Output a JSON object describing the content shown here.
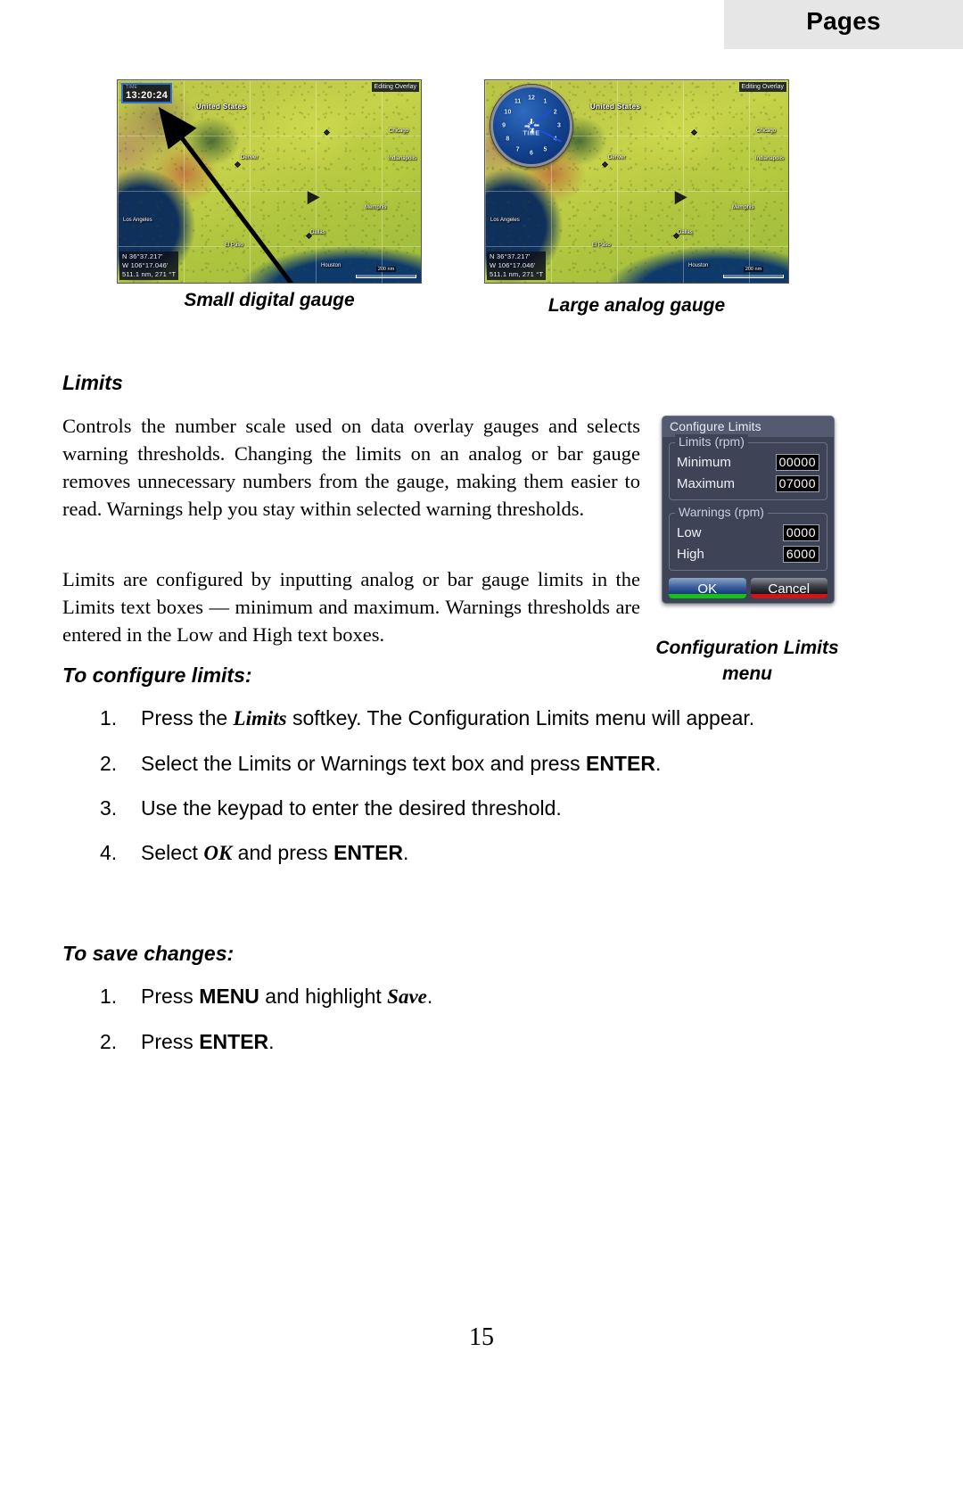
{
  "header": {
    "title": "Pages"
  },
  "figures": [
    {
      "caption": "Small digital gauge",
      "overlay_edit": "Editing Overlay",
      "gauge_label": "TIME",
      "gauge_value": "13:20:24",
      "position_lines": [
        "N 36°37.217'",
        "W 106°17.046'",
        "511.1 nm, 271 °T"
      ],
      "scale": "200 nm",
      "map_labels": [
        "United States",
        "Chicago",
        "Indianapolis",
        "Denver",
        "Memphis",
        "Dallas",
        "Houston",
        "El Paso",
        "Los Angeles"
      ]
    },
    {
      "caption": "Large analog gauge",
      "overlay_edit": "Editing Overlay",
      "gauge_label": "TIME",
      "gauge_numbers": [
        "12",
        "1",
        "2",
        "3",
        "4",
        "5",
        "6",
        "7",
        "8",
        "9",
        "10",
        "11"
      ],
      "position_lines": [
        "N 36°37.217'",
        "W 106°17.046'",
        "511.1 nm, 271 °T"
      ],
      "scale": "200 nm",
      "map_labels": [
        "United States",
        "Chicago",
        "Indianapolis",
        "Denver",
        "Memphis",
        "Dallas",
        "Houston",
        "El Paso",
        "Los Angeles"
      ]
    }
  ],
  "limits": {
    "heading": "Limits",
    "paragraph1": "Controls the number scale used on data overlay gauges and selects warning thresholds. Changing the limits on an analog or bar gauge removes unnecessary numbers from the gauge, making them easier to read. Warnings help you stay within selected warning thresholds.",
    "paragraph2": "Limits are configured by inputting analog or bar gauge limits in the Limits text boxes — minimum and maximum. Warnings thresholds are entered in the Low and High text boxes."
  },
  "dialog": {
    "title": "Configure Limits",
    "groups": [
      {
        "legend": "Limits (rpm)",
        "rows": [
          {
            "label": "Minimum",
            "value": "00000"
          },
          {
            "label": "Maximum",
            "value": "07000"
          }
        ]
      },
      {
        "legend": "Warnings (rpm)",
        "rows": [
          {
            "label": "Low",
            "value": "0000"
          },
          {
            "label": "High",
            "value": "6000"
          }
        ]
      }
    ],
    "ok_label": "OK",
    "cancel_label": "Cancel",
    "caption": "Configuration Limits menu"
  },
  "procedures": [
    {
      "heading": "To configure limits:",
      "steps": [
        {
          "num": "1.",
          "pre": "Press the ",
          "em": "Limits",
          "post": " softkey. The Configuration Limits menu will appear."
        },
        {
          "num": "2.",
          "pre": "Select the Limits or Warnings text box and press ",
          "strong": "ENTER",
          "post": "."
        },
        {
          "num": "3.",
          "pre": "Use the keypad to enter the desired threshold.",
          "em": "",
          "post": ""
        },
        {
          "num": "4.",
          "pre": "Select ",
          "em": "OK",
          "mid": " and press ",
          "strong": "ENTER",
          "post": "."
        }
      ]
    },
    {
      "heading": "To save changes:",
      "steps": [
        {
          "num": "1.",
          "pre": "Press ",
          "strong": "MENU",
          "mid": " and highlight ",
          "em": "Save",
          "post": "."
        },
        {
          "num": "2.",
          "pre": "Press ",
          "strong": "ENTER",
          "post": "."
        }
      ]
    }
  ],
  "page_number": "15",
  "colors": {
    "header_band": "#e6e6e6",
    "dialog_bg": "#3e4455",
    "dialog_title_bg": "#545b70",
    "ok_underline": "#15c21a",
    "cancel_underline": "#cf1616"
  }
}
